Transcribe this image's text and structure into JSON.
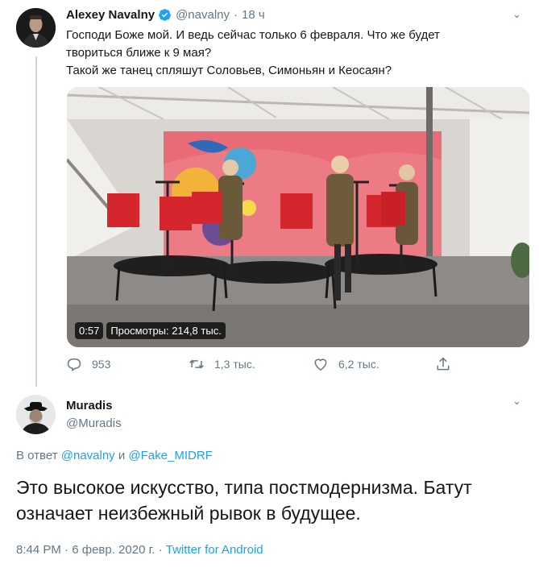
{
  "tweet": {
    "author_name": "Alexey Navalny",
    "handle": "@navalny",
    "separator": "·",
    "time": "18 ч",
    "text_line1": "Господи Боже мой. И ведь сейчас только 6 февраля. Что же будет",
    "text_line2": "твориться ближе к 9 мая?",
    "text_line3": "Такой же танец спляшут Соловьев, Симоньян и Кеосаян?",
    "video_duration": "0:57",
    "video_views": "Просмотры: 214,8 тыс.",
    "replies": "953",
    "retweets": "1,3 тыс.",
    "likes": "6,2 тыс."
  },
  "reply": {
    "author_name": "Muradis",
    "handle": "@Muradis",
    "in_reply_prefix": "В ответ",
    "mention1": "@navalny",
    "conj": "и",
    "mention2": "@Fake_MIDRF",
    "text_line1": "Это высокое искусство, типа постмодернизма. Батут",
    "text_line2": "означает неизбежный рывок в будущее.",
    "time": "8:44 PM",
    "date": "6 февр. 2020 г.",
    "source": "Twitter for Android",
    "dot": "·"
  },
  "colors": {
    "accent": "#1da1f2",
    "secondary_text": "#657786",
    "primary_text": "#14171a"
  },
  "icons": [
    "verified-icon",
    "chevron-down-icon",
    "reply-icon",
    "retweet-icon",
    "like-icon",
    "share-icon"
  ]
}
